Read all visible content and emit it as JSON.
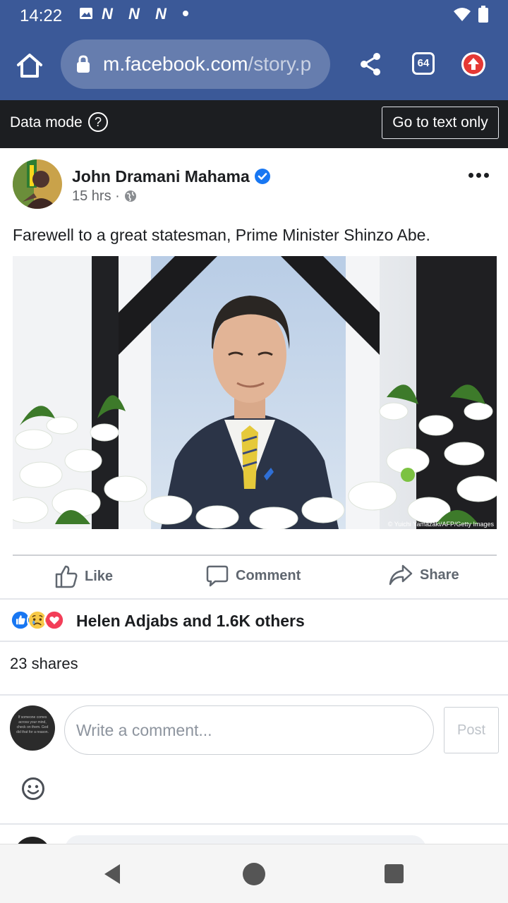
{
  "status_bar": {
    "time": "14:22",
    "notification_icons": [
      "image-icon",
      "n-icon",
      "n-icon",
      "n-icon",
      "dot-icon"
    ],
    "right_icons": [
      "wifi-icon",
      "battery-icon"
    ]
  },
  "browser": {
    "url_domain": "m.facebook.com",
    "url_path": "/story.p",
    "tab_count": "64",
    "theme_color": "#3b5998"
  },
  "data_mode": {
    "label": "Data mode",
    "help_symbol": "?",
    "text_only_button": "Go to text only"
  },
  "post": {
    "author": "John Dramani Mahama",
    "verified": true,
    "time": "15 hrs",
    "separator": "·",
    "text": "Farewell to a great statesman, Prime Minister Shinzo Abe.",
    "photo_credit": "© Yuichi Yamazaki/AFP/Getty Images"
  },
  "actions": {
    "like": "Like",
    "comment": "Comment",
    "share": "Share"
  },
  "engagement": {
    "reaction_icons": [
      "like-reaction-icon",
      "sad-reaction-icon",
      "love-reaction-icon"
    ],
    "reactions_text": "Helen Adjabs and 1.6K others",
    "shares_text": "23 shares"
  },
  "comment_box": {
    "placeholder": "Write a comment...",
    "post_button": "Post",
    "avatar_text": "If someone comes across your mind, check on them. God did that for a reason."
  }
}
